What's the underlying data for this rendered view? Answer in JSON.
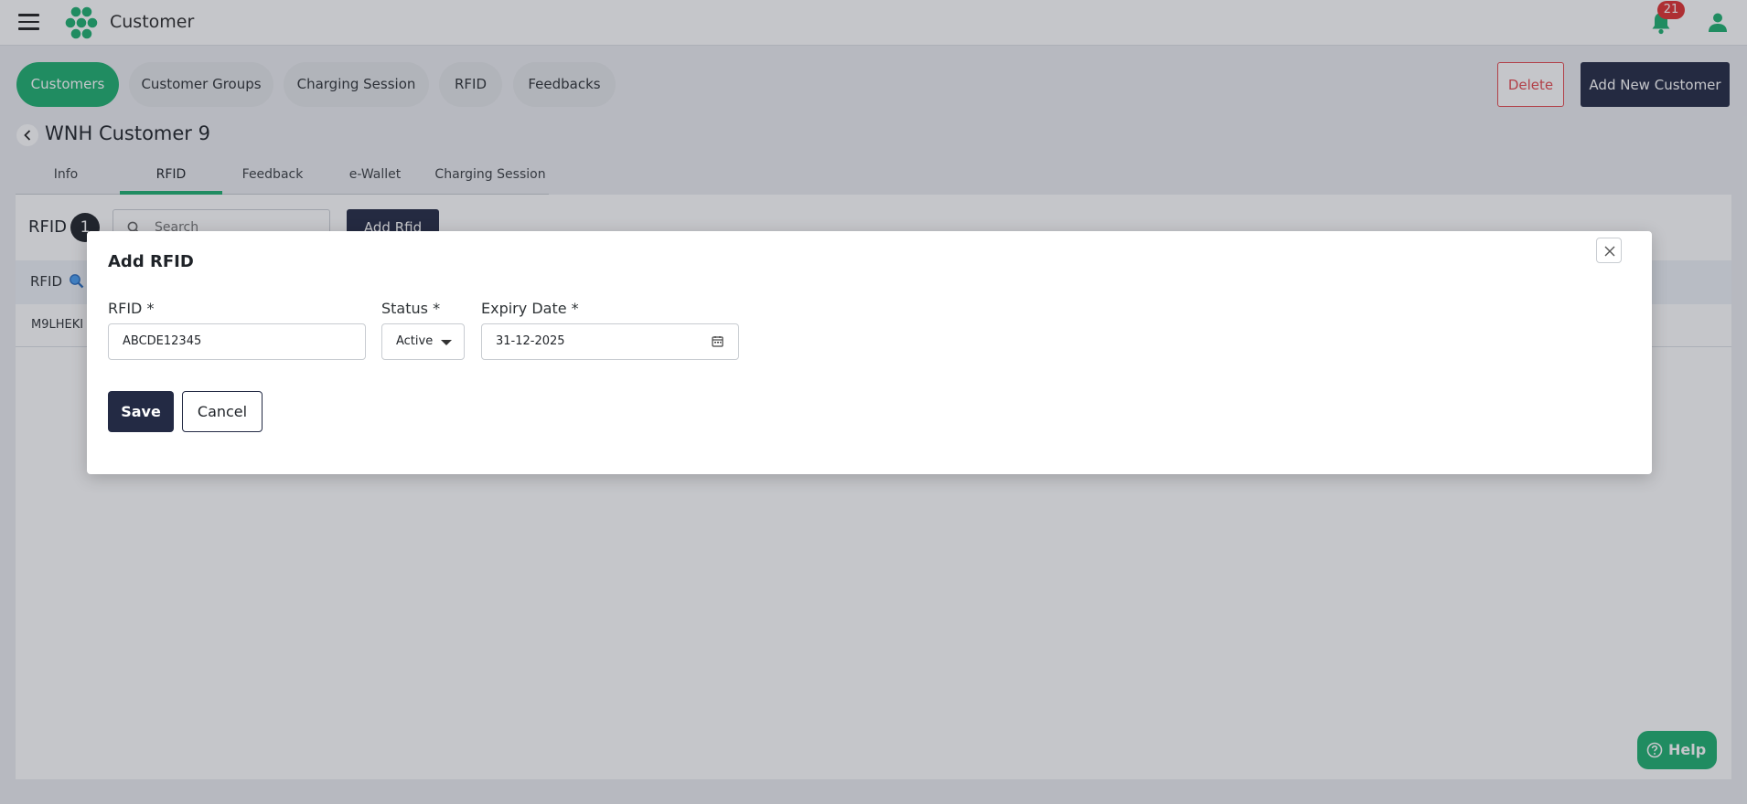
{
  "header": {
    "app_title": "Customer",
    "notification_count": "21",
    "brand_color": "#1db070"
  },
  "nav_pills": [
    {
      "label": "Customers",
      "active": true
    },
    {
      "label": "Customer Groups",
      "active": false
    },
    {
      "label": "Charging Session",
      "active": false
    },
    {
      "label": "RFID",
      "active": false
    },
    {
      "label": "Feedbacks",
      "active": false
    }
  ],
  "actions": {
    "delete_label": "Delete",
    "add_customer_label": "Add New Customer"
  },
  "customer": {
    "name": "WNH Customer 9"
  },
  "tabs": [
    {
      "label": "Info",
      "active": false
    },
    {
      "label": "RFID",
      "active": true
    },
    {
      "label": "Feedback",
      "active": false
    },
    {
      "label": "e-Wallet",
      "active": false
    },
    {
      "label": "Charging Session",
      "active": false
    }
  ],
  "rfid_panel": {
    "title": "RFID",
    "count": "1",
    "search_placeholder": "Search",
    "add_button_label": "Add Rfid",
    "column_header": "RFID",
    "rows": [
      {
        "rfid": "M9LHEKI"
      }
    ]
  },
  "help": {
    "label": "Help"
  },
  "modal": {
    "title": "Add RFID",
    "rfid_label": "RFID *",
    "rfid_value": "ABCDE12345",
    "status_label": "Status *",
    "status_value": "Active",
    "expiry_label": "Expiry Date *",
    "expiry_value": "31-12-2025",
    "save_label": "Save",
    "cancel_label": "Cancel"
  },
  "icons": [
    "menu-icon",
    "logo-icon",
    "bell-icon",
    "user-icon",
    "chevron-left-icon",
    "search-icon",
    "search-filter-icon",
    "help-circle-icon",
    "close-icon",
    "calendar-icon",
    "caret-down-icon"
  ]
}
